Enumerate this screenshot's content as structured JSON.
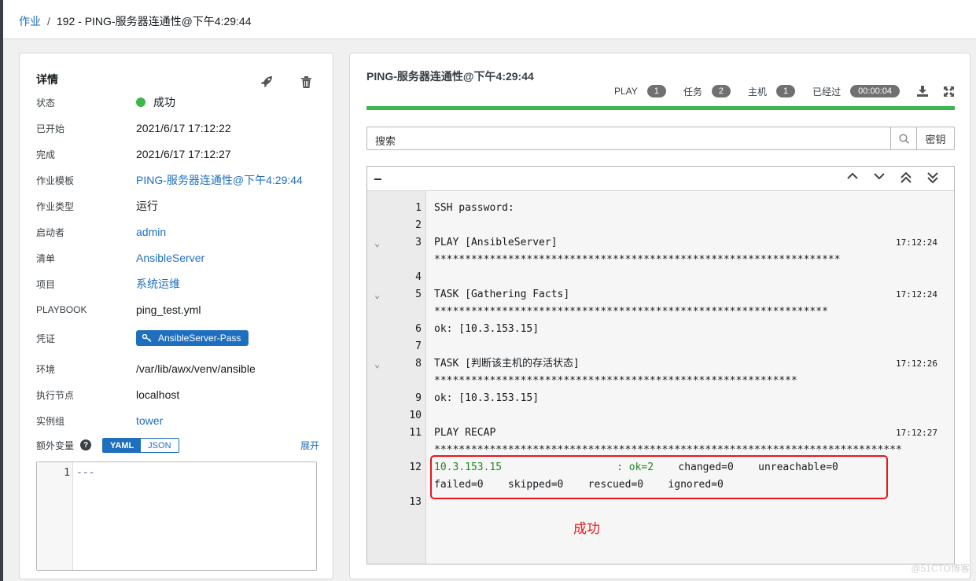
{
  "breadcrumb": {
    "root": "作业",
    "sep": "/",
    "current": "192 - PING-服务器连通性@下午4:29:44"
  },
  "details": {
    "title": "详情",
    "rows": [
      {
        "label": "状态",
        "value": "成功"
      },
      {
        "label": "已开始",
        "value": "2021/6/17 17:12:22"
      },
      {
        "label": "完成",
        "value": "2021/6/17 17:12:27"
      },
      {
        "label": "作业模板",
        "value": "PING-服务器连通性@下午4:29:44"
      },
      {
        "label": "作业类型",
        "value": "运行"
      },
      {
        "label": "启动者",
        "value": "admin"
      },
      {
        "label": "清单",
        "value": "AnsibleServer"
      },
      {
        "label": "项目",
        "value": "系统运维"
      },
      {
        "label": "PLAYBOOK",
        "value": "ping_test.yml"
      },
      {
        "label": "凭证",
        "value": "AnsibleServer-Pass"
      },
      {
        "label": "环境",
        "value": "/var/lib/awx/venv/ansible"
      },
      {
        "label": "执行节点",
        "value": "localhost"
      },
      {
        "label": "实例组",
        "value": "tower"
      }
    ],
    "extra_vars": {
      "label": "额外变量",
      "help": "?",
      "yaml": "YAML",
      "json": "JSON",
      "expand": "展开",
      "line_num": "1",
      "content": "---"
    }
  },
  "output": {
    "title": "PING-服务器连通性@下午4:29:44",
    "stats": {
      "play_label": "PLAY",
      "play": "1",
      "tasks_label": "任务",
      "tasks": "2",
      "hosts_label": "主机",
      "hosts": "1",
      "elapsed_label": "已经过",
      "elapsed": "00:00:04"
    },
    "search_placeholder": "搜索",
    "key_button": "密钥",
    "collapse": "−",
    "lines": [
      {
        "num": "1",
        "text": "SSH password:",
        "time": ""
      },
      {
        "num": "2",
        "text": "",
        "time": ""
      },
      {
        "num": "3",
        "text": "PLAY [AnsibleServer] ******************************************************************",
        "time": "17:12:24"
      },
      {
        "num": "4",
        "text": "",
        "time": ""
      },
      {
        "num": "5",
        "text": "TASK [Gathering Facts] ****************************************************************",
        "time": "17:12:24"
      },
      {
        "num": "6",
        "text": "ok: [10.3.153.15]",
        "time": ""
      },
      {
        "num": "7",
        "text": "",
        "time": ""
      },
      {
        "num": "8",
        "text": "TASK [判断该主机的存活状态] ***********************************************************",
        "time": "17:12:26"
      },
      {
        "num": "9",
        "text": "ok: [10.3.153.15]",
        "time": ""
      },
      {
        "num": "10",
        "text": "",
        "time": ""
      },
      {
        "num": "11",
        "text": "PLAY RECAP ****************************************************************************",
        "time": "17:12:27"
      },
      {
        "num": "12",
        "host": "10.3.153.15",
        "ok": ": ok=2",
        "rest1": "    changed=0    unreachable=0",
        "rest2": "failed=0    skipped=0    rescued=0    ignored=0"
      },
      {
        "num": "13",
        "text": "",
        "time": ""
      }
    ],
    "annotation": "成功"
  },
  "watermark": "@51CTO博客",
  "colors": {
    "accent": "#1f6fbf",
    "success": "#3cb54a",
    "annotation": "#e8161b"
  }
}
